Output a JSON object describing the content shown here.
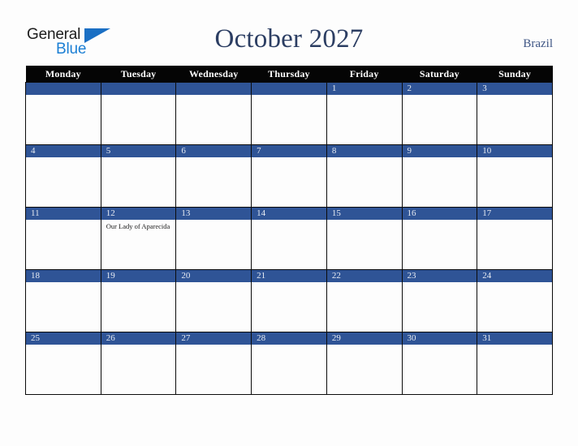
{
  "logo": {
    "word_one": "General",
    "word_two": "Blue",
    "triangle_color": "#1a6fc4",
    "icon": "triangle-flag-icon"
  },
  "header": {
    "title": "October 2027",
    "country": "Brazil",
    "title_color": "#2c3e63",
    "country_color": "#3e5584"
  },
  "calendar": {
    "accent_color": "#2f5496",
    "header_bg": "#050505",
    "weekday_headers": [
      "Monday",
      "Tuesday",
      "Wednesday",
      "Thursday",
      "Friday",
      "Saturday",
      "Sunday"
    ],
    "weeks": [
      [
        {
          "day": "",
          "events": []
        },
        {
          "day": "",
          "events": []
        },
        {
          "day": "",
          "events": []
        },
        {
          "day": "",
          "events": []
        },
        {
          "day": "1",
          "events": []
        },
        {
          "day": "2",
          "events": []
        },
        {
          "day": "3",
          "events": []
        }
      ],
      [
        {
          "day": "4",
          "events": []
        },
        {
          "day": "5",
          "events": []
        },
        {
          "day": "6",
          "events": []
        },
        {
          "day": "7",
          "events": []
        },
        {
          "day": "8",
          "events": []
        },
        {
          "day": "9",
          "events": []
        },
        {
          "day": "10",
          "events": []
        }
      ],
      [
        {
          "day": "11",
          "events": []
        },
        {
          "day": "12",
          "events": [
            "Our Lady of Aparecida"
          ]
        },
        {
          "day": "13",
          "events": []
        },
        {
          "day": "14",
          "events": []
        },
        {
          "day": "15",
          "events": []
        },
        {
          "day": "16",
          "events": []
        },
        {
          "day": "17",
          "events": []
        }
      ],
      [
        {
          "day": "18",
          "events": []
        },
        {
          "day": "19",
          "events": []
        },
        {
          "day": "20",
          "events": []
        },
        {
          "day": "21",
          "events": []
        },
        {
          "day": "22",
          "events": []
        },
        {
          "day": "23",
          "events": []
        },
        {
          "day": "24",
          "events": []
        }
      ],
      [
        {
          "day": "25",
          "events": []
        },
        {
          "day": "26",
          "events": []
        },
        {
          "day": "27",
          "events": []
        },
        {
          "day": "28",
          "events": []
        },
        {
          "day": "29",
          "events": []
        },
        {
          "day": "30",
          "events": []
        },
        {
          "day": "31",
          "events": []
        }
      ]
    ]
  }
}
